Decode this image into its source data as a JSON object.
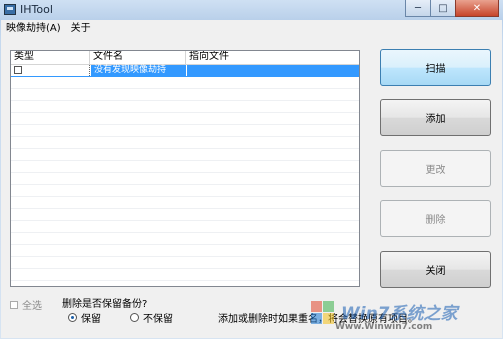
{
  "window": {
    "title": "IHTool",
    "minimize": "─",
    "maximize": "□",
    "close": "✕"
  },
  "menu": [
    "映像劫持(A)",
    "关于"
  ],
  "table": {
    "columns": [
      "类型",
      "文件名",
      "指向文件"
    ],
    "rows": [
      {
        "checked": false,
        "filename": "没有发现映像劫持",
        "target": ""
      }
    ]
  },
  "buttons": {
    "scan": "扫描",
    "add": "添加",
    "edit": "更改",
    "delete": "删除",
    "close": "关闭"
  },
  "select_all": "全选",
  "backup": {
    "title": "删除是否保留备份?",
    "keep": "保留",
    "no_keep": "不保留",
    "selected": "keep"
  },
  "note": "添加或删除时如果重名，将会替换原有项目。",
  "watermark": {
    "brand": "Win7系统之家",
    "url": "Www.Winwin7.com"
  }
}
